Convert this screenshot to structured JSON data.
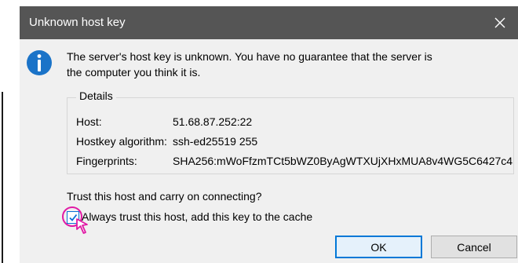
{
  "dialog": {
    "title": "Unknown host key",
    "message_line1": "The server's host key is unknown. You have no guarantee that the server is",
    "message_line2": "the computer you think it is.",
    "details": {
      "legend": "Details",
      "rows": [
        {
          "label": "Host:",
          "value": "51.68.87.252:22"
        },
        {
          "label": "Hostkey algorithm:",
          "value": "ssh-ed25519 255"
        },
        {
          "label": "Fingerprints:",
          "value": "SHA256:mWoFfzmTCt5bWZ0ByAgWTXUjXHxMUA8v4WG5C6427c4"
        }
      ]
    },
    "question": "Trust this host and carry on connecting?",
    "checkbox": {
      "label": "Always trust this host, add this key to the cache",
      "checked": true
    },
    "buttons": {
      "ok": "OK",
      "cancel": "Cancel"
    }
  },
  "icons": {
    "title_close": "close-icon",
    "info": "info-icon",
    "check": "checkmark-icon",
    "cursor": "mouse-pointer-icon"
  },
  "colors": {
    "titlebar": "#555555",
    "dialog_bg": "#f0f0f0",
    "info_icon": "#1a73c8",
    "ok_border": "#0078d7",
    "focus_ring": "#e01aa5"
  }
}
